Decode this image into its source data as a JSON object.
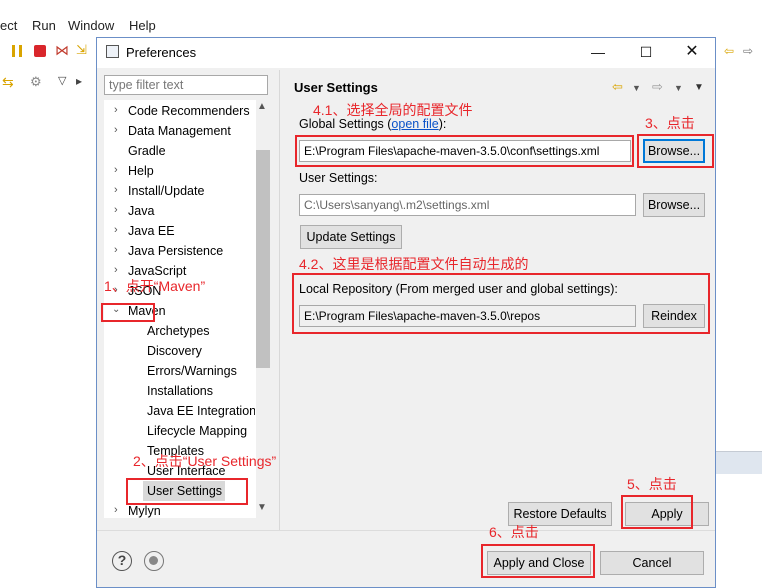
{
  "background_window": {
    "menu": [
      "ect",
      "Run",
      "Window",
      "Help"
    ]
  },
  "dialog": {
    "title": "Preferences",
    "filter_placeholder": "type filter text",
    "tree": [
      {
        "label": "Code Recommenders",
        "expandable": true
      },
      {
        "label": "Data Management",
        "expandable": true
      },
      {
        "label": "Gradle",
        "expandable": false
      },
      {
        "label": "Help",
        "expandable": true
      },
      {
        "label": "Install/Update",
        "expandable": true
      },
      {
        "label": "Java",
        "expandable": true
      },
      {
        "label": "Java EE",
        "expandable": true
      },
      {
        "label": "Java Persistence",
        "expandable": true
      },
      {
        "label": "JavaScript",
        "expandable": true
      },
      {
        "label": "JSON",
        "expandable": true
      },
      {
        "label": "Maven",
        "expandable": true,
        "expanded": true
      },
      {
        "label": "Archetypes",
        "child": true
      },
      {
        "label": "Discovery",
        "child": true
      },
      {
        "label": "Errors/Warnings",
        "child": true
      },
      {
        "label": "Installations",
        "child": true
      },
      {
        "label": "Java EE Integration",
        "child": true
      },
      {
        "label": "Lifecycle Mapping",
        "child": true
      },
      {
        "label": "Templates",
        "child": true
      },
      {
        "label": "User Interface",
        "child": true
      },
      {
        "label": "User Settings",
        "child": true,
        "selected": true
      },
      {
        "label": "Mylyn",
        "expandable": true
      }
    ],
    "page": {
      "title": "User Settings",
      "global_settings_label": "Global Settings (",
      "global_settings_link": "open file",
      "global_settings_label_end": "):",
      "global_settings_value": "E:\\Program Files\\apache-maven-3.5.0\\conf\\settings.xml",
      "browse_label": "Browse...",
      "user_settings_label": "User Settings:",
      "user_settings_value": "C:\\Users\\sanyang\\.m2\\settings.xml",
      "update_settings_label": "Update Settings",
      "local_repo_label": "Local Repository (From merged user and global settings):",
      "local_repo_value": "E:\\Program Files\\apache-maven-3.5.0\\repos",
      "reindex_label": "Reindex"
    },
    "buttons": {
      "restore_defaults": "Restore Defaults",
      "apply": "Apply",
      "apply_and_close": "Apply and Close",
      "cancel": "Cancel"
    }
  },
  "annotations": {
    "step1": "1、点开“Maven”",
    "step2": "2、点击“User Settings”",
    "step3": "3、点击",
    "step41": "4.1、选择全局的配置文件",
    "step42": "4.2、这里是根据配置文件自动生成的",
    "step5": "5、点击",
    "step6": "6、点击"
  },
  "colors": {
    "annotation_red": "#e8262b",
    "link_blue": "#0a52c8",
    "focus_blue": "#0078d7"
  }
}
